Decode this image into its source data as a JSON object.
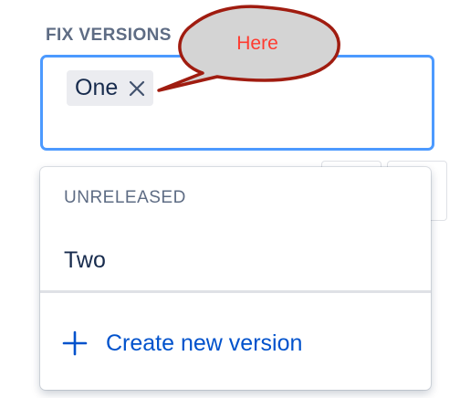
{
  "field": {
    "label": "FIX VERSIONS",
    "selected": [
      {
        "label": "One",
        "remove_icon": "close-icon"
      }
    ]
  },
  "dropdown": {
    "group_heading": "UNRELEASED",
    "options": [
      {
        "label": "Two"
      }
    ],
    "create": {
      "icon": "plus-icon",
      "label": "Create new version"
    }
  },
  "annotation": {
    "text": "Here",
    "text_color": "#ff3b30",
    "border_color": "#a01c10",
    "fill_color": "#d4d4d4"
  },
  "colors": {
    "focus_border": "#4c9aff",
    "link": "#0052cc",
    "text": "#172b4d",
    "subtle_text": "#5e6c84"
  }
}
